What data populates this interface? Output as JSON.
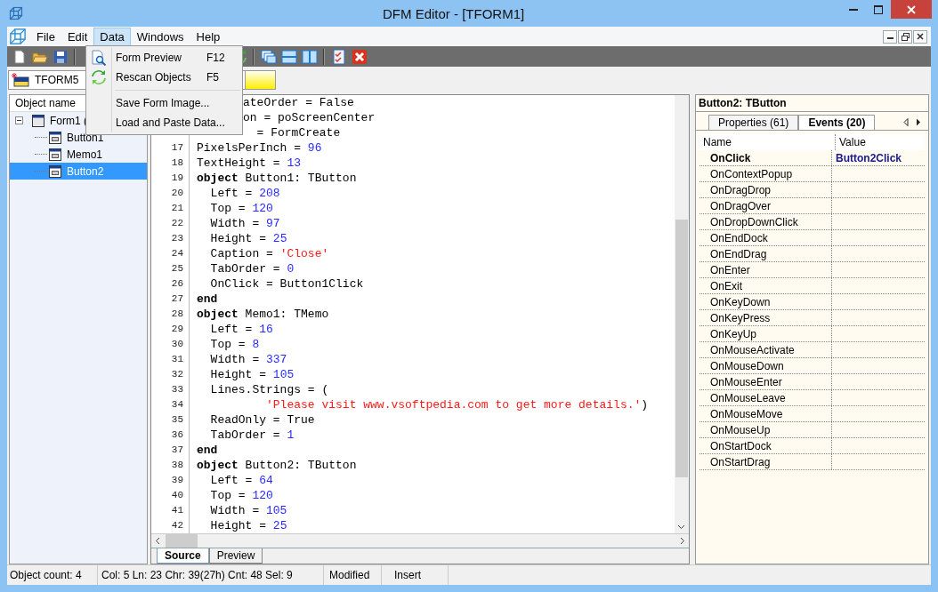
{
  "window": {
    "title": "DFM Editor - [TFORM1]"
  },
  "menu": [
    {
      "label": "File",
      "selected": false
    },
    {
      "label": "Edit",
      "selected": false
    },
    {
      "label": "Data",
      "selected": true
    },
    {
      "label": "Windows",
      "selected": false
    },
    {
      "label": "Help",
      "selected": false
    }
  ],
  "data_menu": [
    {
      "kind": "item",
      "label": "Form Preview",
      "shortcut": "F12"
    },
    {
      "kind": "item",
      "label": "Rescan Objects",
      "shortcut": "F5"
    },
    {
      "kind": "separator"
    },
    {
      "kind": "item",
      "label": "Save Form Image..."
    },
    {
      "kind": "item",
      "label": "Load and Paste Data..."
    }
  ],
  "form_selector": {
    "value": "TFORM5"
  },
  "object_tree": {
    "header": "Object name",
    "items": [
      {
        "label": "Form1 (",
        "expanded": true,
        "selected": false,
        "children": [
          {
            "label": "Button1",
            "selected": false
          },
          {
            "label": "Memo1",
            "selected": false
          },
          {
            "label": "Button2",
            "selected": true
          }
        ]
      }
    ]
  },
  "editor": {
    "lines": [
      {
        "kind": "covered",
        "tokens": [
          {
            "kind": "plain",
            "text": "ateOrder = False"
          }
        ]
      },
      {
        "kind": "covered",
        "tokens": [
          {
            "kind": "plain",
            "text": "on = poScreenCenter"
          }
        ]
      },
      {
        "kind": "covered",
        "tokens": [
          {
            "kind": "plain",
            "text": "  = FormCreate"
          }
        ]
      },
      {
        "kind": "line",
        "number": "17",
        "tokens": [
          {
            "kind": "plain",
            "text": "PixelsPerInch = "
          },
          {
            "kind": "number",
            "text": "96"
          }
        ]
      },
      {
        "kind": "line",
        "number": "18",
        "tokens": [
          {
            "kind": "plain",
            "text": "TextHeight = "
          },
          {
            "kind": "number",
            "text": "13"
          }
        ]
      },
      {
        "kind": "line",
        "number": "19",
        "tokens": [
          {
            "kind": "keyword",
            "text": "object"
          },
          {
            "kind": "plain",
            "text": " Button1: TButton"
          }
        ]
      },
      {
        "kind": "line",
        "number": "20",
        "tokens": [
          {
            "kind": "plain",
            "text": "  Left = "
          },
          {
            "kind": "number",
            "text": "208"
          }
        ]
      },
      {
        "kind": "line",
        "number": "21",
        "tokens": [
          {
            "kind": "plain",
            "text": "  Top = "
          },
          {
            "kind": "number",
            "text": "120"
          }
        ]
      },
      {
        "kind": "line",
        "number": "22",
        "tokens": [
          {
            "kind": "plain",
            "text": "  Width = "
          },
          {
            "kind": "number",
            "text": "97"
          }
        ]
      },
      {
        "kind": "line",
        "number": "23",
        "tokens": [
          {
            "kind": "plain",
            "text": "  Height = "
          },
          {
            "kind": "number",
            "text": "25"
          }
        ]
      },
      {
        "kind": "line",
        "number": "24",
        "tokens": [
          {
            "kind": "plain",
            "text": "  Caption = "
          },
          {
            "kind": "string",
            "text": "'Close'"
          }
        ]
      },
      {
        "kind": "line",
        "number": "25",
        "tokens": [
          {
            "kind": "plain",
            "text": "  TabOrder = "
          },
          {
            "kind": "number",
            "text": "0"
          }
        ]
      },
      {
        "kind": "line",
        "number": "26",
        "tokens": [
          {
            "kind": "plain",
            "text": "  OnClick = Button1Click"
          }
        ]
      },
      {
        "kind": "line",
        "number": "27",
        "tokens": [
          {
            "kind": "keyword",
            "text": "end"
          }
        ]
      },
      {
        "kind": "line",
        "number": "28",
        "tokens": [
          {
            "kind": "keyword",
            "text": "object"
          },
          {
            "kind": "plain",
            "text": " Memo1: TMemo"
          }
        ]
      },
      {
        "kind": "line",
        "number": "29",
        "tokens": [
          {
            "kind": "plain",
            "text": "  Left = "
          },
          {
            "kind": "number",
            "text": "16"
          }
        ]
      },
      {
        "kind": "line",
        "number": "30",
        "tokens": [
          {
            "kind": "plain",
            "text": "  Top = "
          },
          {
            "kind": "number",
            "text": "8"
          }
        ]
      },
      {
        "kind": "line",
        "number": "31",
        "tokens": [
          {
            "kind": "plain",
            "text": "  Width = "
          },
          {
            "kind": "number",
            "text": "337"
          }
        ]
      },
      {
        "kind": "line",
        "number": "32",
        "tokens": [
          {
            "kind": "plain",
            "text": "  Height = "
          },
          {
            "kind": "number",
            "text": "105"
          }
        ]
      },
      {
        "kind": "line",
        "number": "33",
        "tokens": [
          {
            "kind": "plain",
            "text": "  Lines.Strings = ("
          }
        ]
      },
      {
        "kind": "line",
        "number": "34",
        "tokens": [
          {
            "kind": "string",
            "text": "          'Please visit www.vsoftpedia.com to get more details.'"
          },
          {
            "kind": "plain",
            "text": ")"
          }
        ]
      },
      {
        "kind": "line",
        "number": "35",
        "tokens": [
          {
            "kind": "plain",
            "text": "  ReadOnly = True"
          }
        ]
      },
      {
        "kind": "line",
        "number": "36",
        "tokens": [
          {
            "kind": "plain",
            "text": "  TabOrder = "
          },
          {
            "kind": "number",
            "text": "1"
          }
        ]
      },
      {
        "kind": "line",
        "number": "37",
        "tokens": [
          {
            "kind": "keyword",
            "text": "end"
          }
        ]
      },
      {
        "kind": "line",
        "number": "38",
        "tokens": [
          {
            "kind": "keyword",
            "text": "object"
          },
          {
            "kind": "plain",
            "text": " Button2: TButton"
          }
        ]
      },
      {
        "kind": "line",
        "number": "39",
        "tokens": [
          {
            "kind": "plain",
            "text": "  Left = "
          },
          {
            "kind": "number",
            "text": "64"
          }
        ]
      },
      {
        "kind": "line",
        "number": "40",
        "tokens": [
          {
            "kind": "plain",
            "text": "  Top = "
          },
          {
            "kind": "number",
            "text": "120"
          }
        ]
      },
      {
        "kind": "line",
        "number": "41",
        "tokens": [
          {
            "kind": "plain",
            "text": "  Width = "
          },
          {
            "kind": "number",
            "text": "105"
          }
        ]
      },
      {
        "kind": "line",
        "number": "42",
        "tokens": [
          {
            "kind": "plain",
            "text": "  Height = "
          },
          {
            "kind": "number",
            "text": "25"
          }
        ]
      }
    ],
    "tabs": [
      {
        "label": "Source",
        "selected": true
      },
      {
        "label": "Preview",
        "selected": false
      }
    ]
  },
  "inspector": {
    "title": "Button2: TButton",
    "tabs": [
      {
        "label": "Properties (61)",
        "selected": false
      },
      {
        "label": "Events (20)",
        "selected": true
      }
    ],
    "columns": [
      "Name",
      "Value"
    ],
    "rows": [
      {
        "name": "OnClick",
        "value": "Button2Click"
      },
      {
        "name": "OnContextPopup"
      },
      {
        "name": "OnDragDrop"
      },
      {
        "name": "OnDragOver"
      },
      {
        "name": "OnDropDownClick"
      },
      {
        "name": "OnEndDock"
      },
      {
        "name": "OnEndDrag"
      },
      {
        "name": "OnEnter"
      },
      {
        "name": "OnExit"
      },
      {
        "name": "OnKeyDown"
      },
      {
        "name": "OnKeyPress"
      },
      {
        "name": "OnKeyUp"
      },
      {
        "name": "OnMouseActivate"
      },
      {
        "name": "OnMouseDown"
      },
      {
        "name": "OnMouseEnter"
      },
      {
        "name": "OnMouseLeave"
      },
      {
        "name": "OnMouseMove"
      },
      {
        "name": "OnMouseUp"
      },
      {
        "name": "OnStartDock"
      },
      {
        "name": "OnStartDrag"
      }
    ]
  },
  "status_bar": [
    "Object count: 4",
    "Col: 5  Ln: 23  Chr: 39(27h)  Cnt: 48  Sel: 9",
    "Modified",
    "Insert"
  ]
}
